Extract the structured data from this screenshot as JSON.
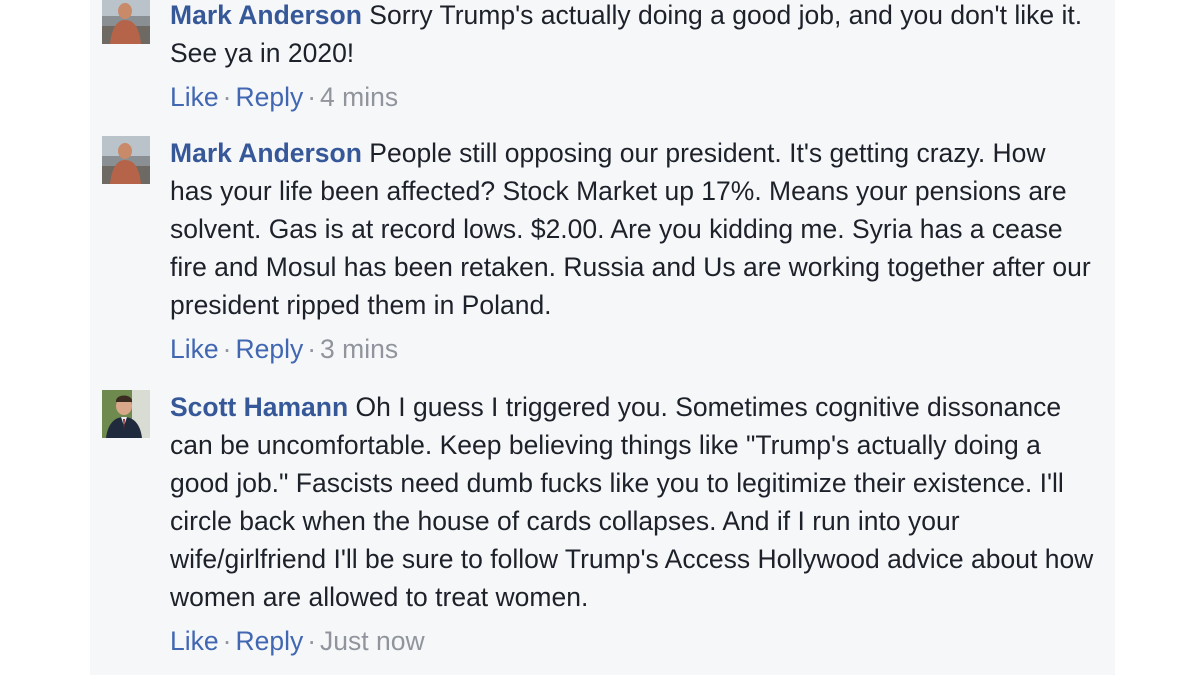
{
  "comments": [
    {
      "author": "Mark Anderson",
      "text": "Sorry Trump's actually doing a good job, and you don't like it. See ya in 2020!",
      "like_label": "Like",
      "reply_label": "Reply",
      "separator": "·",
      "time": "4 mins",
      "avatar_icon": "profile-photo-mark"
    },
    {
      "author": "Mark Anderson",
      "text": "People still opposing our president. It's getting crazy. How has your life been affected? Stock Market up 17%. Means your pensions are solvent. Gas is at record lows. $2.00. Are you kidding me. Syria has a cease fire and Mosul has been retaken. Russia and Us are working together after our president ripped them in Poland.",
      "like_label": "Like",
      "reply_label": "Reply",
      "separator": "·",
      "time": "3 mins",
      "avatar_icon": "profile-photo-mark"
    },
    {
      "author": "Scott Hamann",
      "text": "Oh I guess I triggered you. Sometimes cognitive dissonance can be uncomfortable. Keep believing things like \"Trump's actually doing a good job.\" Fascists need dumb fucks like you to legitimize their existence. I'll circle back when the house of cards collapses. And if I run into your wife/girlfriend I'll be sure to follow Trump's Access Hollywood advice about how women are allowed to treat women.",
      "like_label": "Like",
      "reply_label": "Reply",
      "separator": "·",
      "time": "Just now",
      "avatar_icon": "profile-photo-scott"
    }
  ],
  "colors": {
    "author_link": "#365899",
    "action_link": "#4267b2",
    "meta_text": "#90949c",
    "body_text": "#1d2129",
    "panel_bg": "#f6f7f9"
  }
}
